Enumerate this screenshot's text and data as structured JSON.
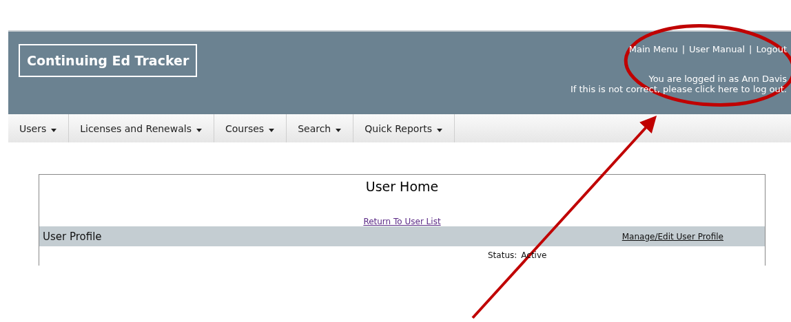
{
  "header": {
    "logo": "Continuing Ed Tracker",
    "top_links": [
      {
        "label": "Main Menu"
      },
      {
        "label": "User Manual"
      },
      {
        "label": "Logout"
      }
    ],
    "separator": "|",
    "login_text": "You are logged in as Ann Davis",
    "logout_prefix": "If this is not correct, please",
    "logout_link": "click here",
    "logout_suffix": "to log out."
  },
  "nav": [
    {
      "label": "Users"
    },
    {
      "label": "Licenses and Renewals"
    },
    {
      "label": "Courses"
    },
    {
      "label": "Search"
    },
    {
      "label": "Quick Reports"
    }
  ],
  "content": {
    "title": "User Home",
    "return_link": "Return To User List",
    "section": {
      "title": "User Profile",
      "action": "Manage/Edit User Profile"
    },
    "status_label": "Status:",
    "status_value": "Active"
  },
  "annotations": [
    {
      "kind": "ellipse"
    },
    {
      "kind": "arrow"
    }
  ]
}
